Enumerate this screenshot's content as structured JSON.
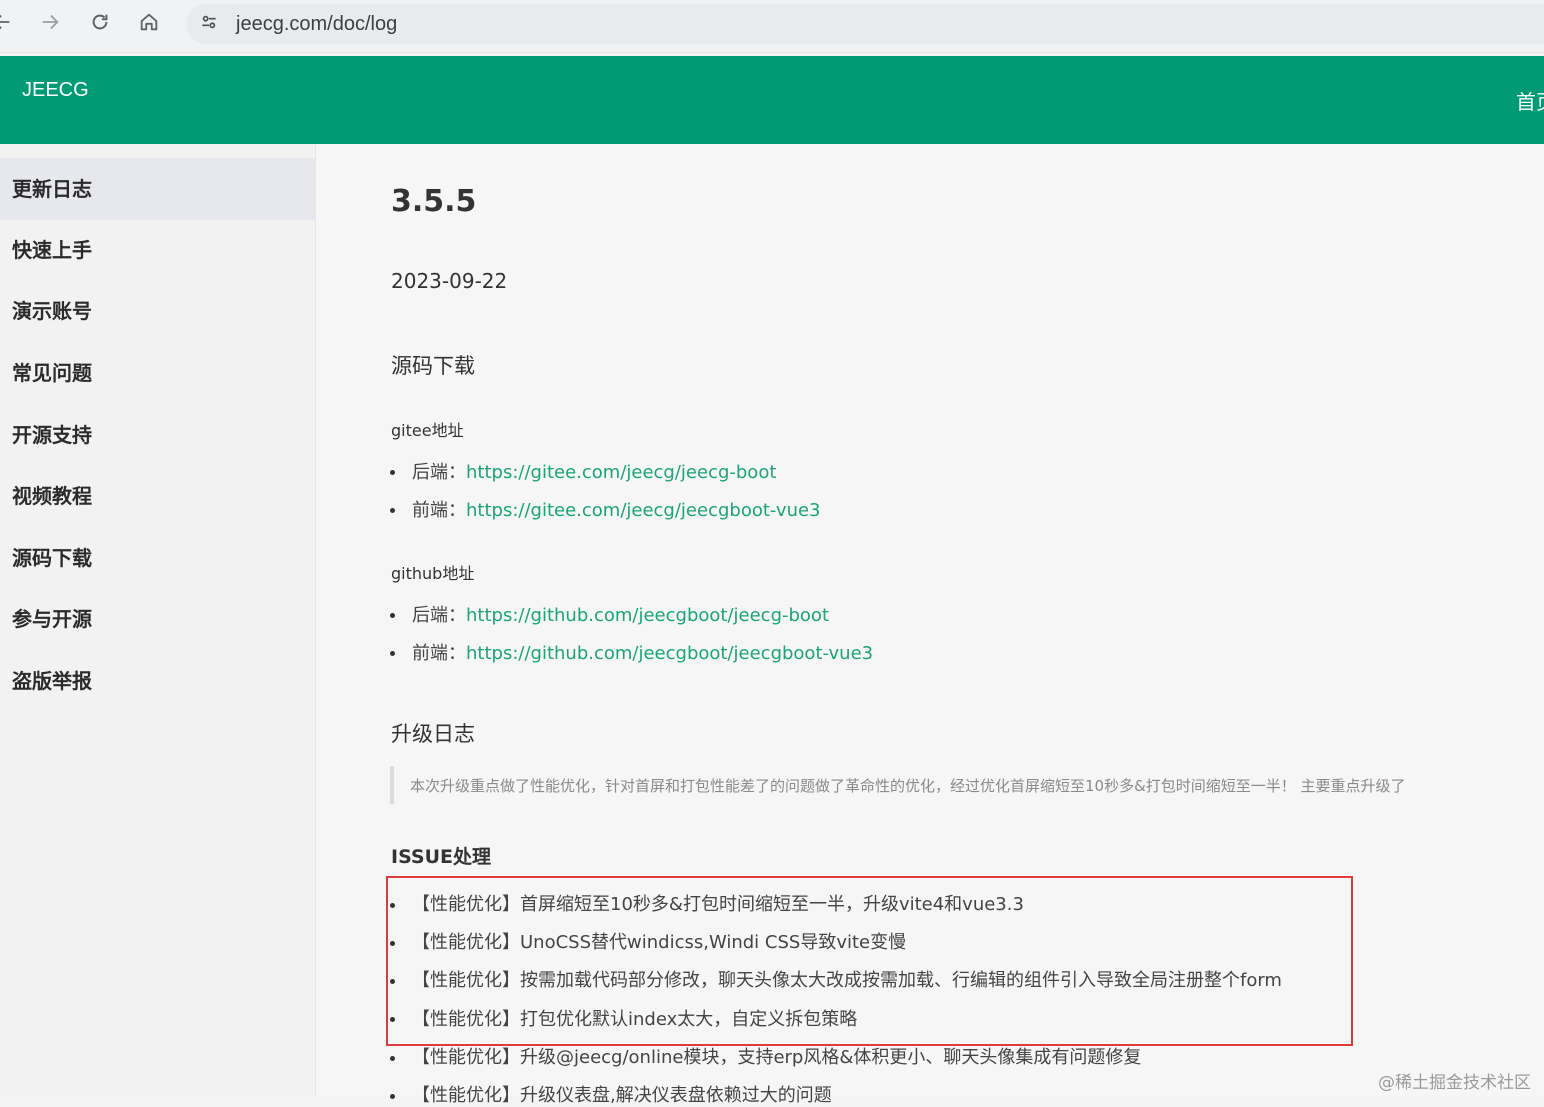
{
  "browser": {
    "url": "jeecg.com/doc/log",
    "back_icon": "arrow-left-icon",
    "forward_icon": "arrow-right-icon",
    "reload_icon": "reload-icon",
    "home_icon": "home-icon",
    "site_info_icon": "tune-icon"
  },
  "header": {
    "brand": "JEECG",
    "nav_first": "首页",
    "background": "#009b75"
  },
  "sidebar": {
    "items": [
      {
        "label": "更新日志"
      },
      {
        "label": "快速上手"
      },
      {
        "label": "演示账号"
      },
      {
        "label": "常见问题"
      },
      {
        "label": "开源支持"
      },
      {
        "label": "视频教程"
      },
      {
        "label": "源码下载"
      },
      {
        "label": "参与开源"
      },
      {
        "label": "盗版举报"
      }
    ],
    "active_index": 0
  },
  "content": {
    "version": "3.5.5",
    "date": "2023-09-22",
    "download_heading": "源码下载",
    "gitee": {
      "heading": "gitee地址",
      "items": [
        {
          "label": "后端：",
          "url": "https://gitee.com/jeecg/jeecg-boot"
        },
        {
          "label": "前端：",
          "url": "https://gitee.com/jeecg/jeecgboot-vue3"
        }
      ]
    },
    "github": {
      "heading": "github地址",
      "items": [
        {
          "label": "后端：",
          "url": "https://github.com/jeecgboot/jeecg-boot"
        },
        {
          "label": "前端：",
          "url": "https://github.com/jeecgboot/jeecgboot-vue3"
        }
      ]
    },
    "log_heading": "升级日志",
    "quote": "本次升级重点做了性能优化，针对首屏和打包性能差了的问题做了革命性的优化，经过优化首屏缩短至10秒多&打包时间缩短至一半！ 主要重点升级了",
    "issue_heading": "ISSUE处理",
    "issues": [
      "【性能优化】首屏缩短至10秒多&打包时间缩短至一半，升级vite4和vue3.3",
      "【性能优化】UnoCSS替代windicss,Windi CSS导致vite变慢",
      "【性能优化】按需加载代码部分修改，聊天头像太大改成按需加载、行编辑的组件引入导致全局注册整个form",
      "【性能优化】打包优化默认index太大，自定义拆包策略",
      "【性能优化】升级@jeecg/online模块，支持erp风格&体积更小、聊天头像集成有问题修复",
      "【性能优化】升级仪表盘,解决仪表盘依赖过大的问题"
    ],
    "highlight_color": "#e03a3a",
    "link_color": "#1aa574"
  },
  "watermark": "@稀土掘金技术社区"
}
